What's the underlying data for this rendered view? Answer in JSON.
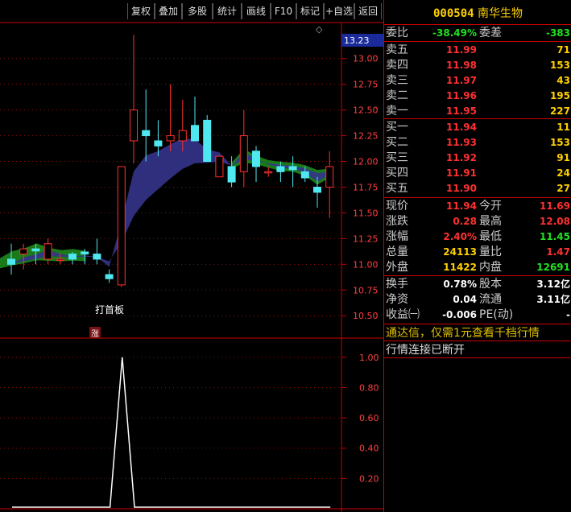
{
  "toolbar": {
    "buttons": [
      "复权",
      "叠加",
      "多股",
      "统计",
      "画线",
      "F10",
      "标记",
      "+自选",
      "返回"
    ]
  },
  "main_chart": {
    "price_ticks": [
      "13.23",
      "13.00",
      "12.75",
      "12.50",
      "12.25",
      "12.00",
      "11.75",
      "11.50",
      "11.25",
      "11.00",
      "10.75",
      "10.50"
    ],
    "annotation": "打首板",
    "zhang_marker": "涨",
    "diamond_icon": "◇"
  },
  "sub_chart": {
    "ticks": [
      "1.00",
      "0.80",
      "0.60",
      "0.40",
      "0.20"
    ]
  },
  "chart_data": [
    {
      "type": "candlestick",
      "ylim": [
        10.4,
        13.35
      ],
      "candles": [
        {
          "o": 11.05,
          "h": 11.2,
          "l": 10.9,
          "c": 11.0
        },
        {
          "o": 11.1,
          "h": 11.2,
          "l": 10.95,
          "c": 11.15
        },
        {
          "o": 11.15,
          "h": 11.2,
          "l": 11.0,
          "c": 11.13
        },
        {
          "o": 11.05,
          "h": 11.25,
          "l": 11.0,
          "c": 11.2
        },
        {
          "o": 11.05,
          "h": 11.1,
          "l": 11.0,
          "c": 11.05
        },
        {
          "o": 11.1,
          "h": 11.12,
          "l": 11.0,
          "c": 11.05
        },
        {
          "o": 11.12,
          "h": 11.15,
          "l": 11.0,
          "c": 11.1
        },
        {
          "o": 11.1,
          "h": 11.25,
          "l": 11.0,
          "c": 11.05
        },
        {
          "o": 10.9,
          "h": 10.95,
          "l": 10.82,
          "c": 10.86
        },
        {
          "o": 10.8,
          "h": 11.95,
          "l": 10.78,
          "c": 11.95
        },
        {
          "o": 12.2,
          "h": 13.23,
          "l": 11.98,
          "c": 12.5
        },
        {
          "o": 12.3,
          "h": 12.7,
          "l": 12.0,
          "c": 12.25
        },
        {
          "o": 12.2,
          "h": 12.4,
          "l": 12.05,
          "c": 12.15
        },
        {
          "o": 12.2,
          "h": 12.75,
          "l": 12.1,
          "c": 12.25
        },
        {
          "o": 12.2,
          "h": 12.6,
          "l": 12.1,
          "c": 12.3
        },
        {
          "o": 12.35,
          "h": 12.63,
          "l": 12.2,
          "c": 12.2
        },
        {
          "o": 12.4,
          "h": 12.45,
          "l": 12.0,
          "c": 12.0
        },
        {
          "o": 11.85,
          "h": 12.0,
          "l": 11.85,
          "c": 12.05
        },
        {
          "o": 11.95,
          "h": 12.05,
          "l": 11.75,
          "c": 11.8
        },
        {
          "o": 11.9,
          "h": 12.5,
          "l": 11.75,
          "c": 12.25
        },
        {
          "o": 12.1,
          "h": 12.15,
          "l": 11.8,
          "c": 11.95
        },
        {
          "o": 11.9,
          "h": 11.95,
          "l": 11.85,
          "c": 11.9
        },
        {
          "o": 11.95,
          "h": 12.0,
          "l": 11.8,
          "c": 11.9
        },
        {
          "o": 11.95,
          "h": 12.05,
          "l": 11.75,
          "c": 11.92
        },
        {
          "o": 11.9,
          "h": 11.95,
          "l": 11.8,
          "c": 11.84
        },
        {
          "o": 11.75,
          "h": 11.85,
          "l": 11.55,
          "c": 11.7
        },
        {
          "o": 11.75,
          "h": 12.1,
          "l": 11.45,
          "c": 11.95
        }
      ]
    },
    {
      "type": "line",
      "ylim": [
        0,
        1.1
      ],
      "values": [
        0,
        0,
        0,
        0,
        0,
        0,
        0,
        0,
        0,
        1.0,
        0,
        0,
        0,
        0,
        0,
        0,
        0,
        0,
        0,
        0,
        0,
        0,
        0,
        0,
        0,
        0,
        0
      ]
    }
  ],
  "panel": {
    "code": "000504",
    "name": "南华生物",
    "weibi": {
      "label": "委比",
      "value": "-38.49%",
      "label2": "委差",
      "value2": "-383"
    },
    "asks": [
      {
        "label": "卖五",
        "price": "11.99",
        "vol": "71"
      },
      {
        "label": "卖四",
        "price": "11.98",
        "vol": "153"
      },
      {
        "label": "卖三",
        "price": "11.97",
        "vol": "43"
      },
      {
        "label": "卖二",
        "price": "11.96",
        "vol": "195"
      },
      {
        "label": "卖一",
        "price": "11.95",
        "vol": "227"
      }
    ],
    "bids": [
      {
        "label": "买一",
        "price": "11.94",
        "vol": "11"
      },
      {
        "label": "买二",
        "price": "11.93",
        "vol": "153"
      },
      {
        "label": "买三",
        "price": "11.92",
        "vol": "91"
      },
      {
        "label": "买四",
        "price": "11.91",
        "vol": "24"
      },
      {
        "label": "买五",
        "price": "11.90",
        "vol": "27"
      }
    ],
    "stats": [
      {
        "l1": "现价",
        "v1": "11.94",
        "c1": "red",
        "l2": "今开",
        "v2": "11.69",
        "c2": "red"
      },
      {
        "l1": "涨跌",
        "v1": "0.28",
        "c1": "red",
        "l2": "最高",
        "v2": "12.08",
        "c2": "red"
      },
      {
        "l1": "涨幅",
        "v1": "2.40%",
        "c1": "red",
        "l2": "最低",
        "v2": "11.45",
        "c2": "green"
      },
      {
        "l1": "总量",
        "v1": "24113",
        "c1": "yellow",
        "l2": "量比",
        "v2": "1.47",
        "c2": "red"
      },
      {
        "l1": "外盘",
        "v1": "11422",
        "c1": "yellow",
        "l2": "内盘",
        "v2": "12691",
        "c2": "green"
      }
    ],
    "fund": [
      {
        "l1": "换手",
        "v1": "0.78%",
        "l2": "股本",
        "v2": "3.12亿"
      },
      {
        "l1": "净资",
        "v1": "0.04",
        "l2": "流通",
        "v2": "3.11亿"
      },
      {
        "l1": "收益㈠",
        "v1": "-0.006",
        "l2": "PE(动)",
        "v2": "-"
      }
    ],
    "notice": "通达信，仅需1元查看千档行情",
    "status": "行情连接已断开"
  }
}
